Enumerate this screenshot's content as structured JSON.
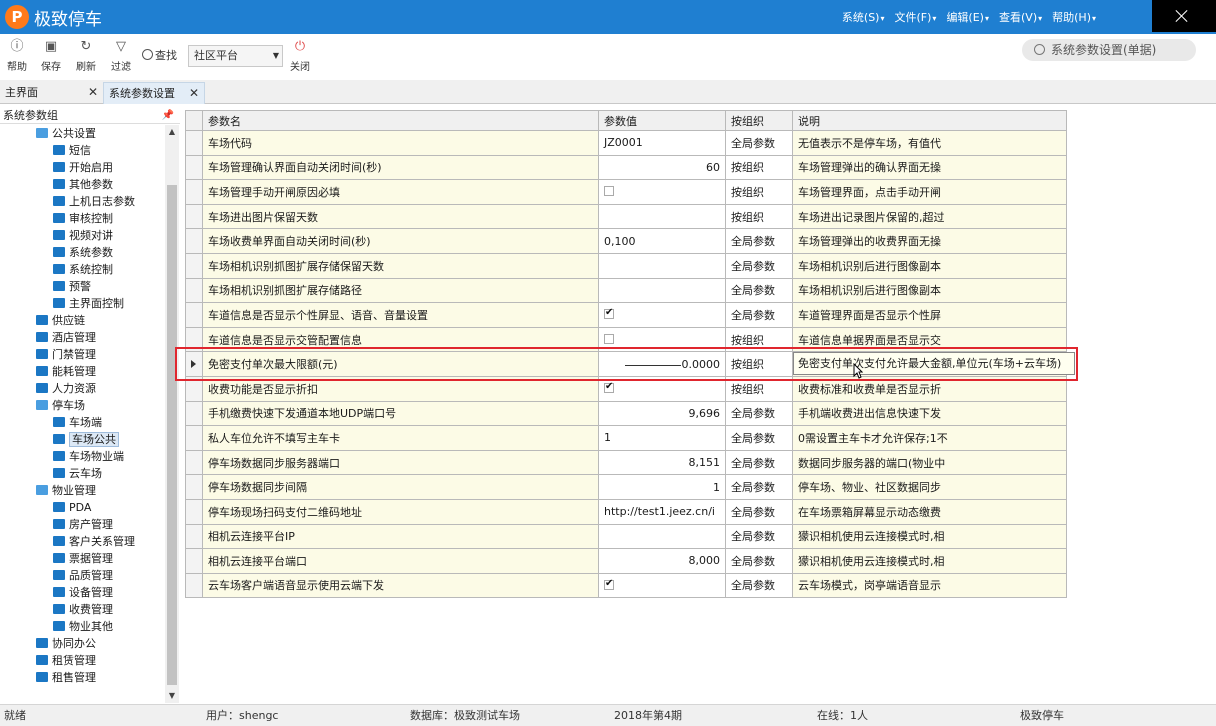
{
  "app": {
    "title": "极致停车",
    "logo_letter": "P"
  },
  "menubar": [
    "系统(S)",
    "文件(F)",
    "编辑(E)",
    "查看(V)",
    "帮助(H)"
  ],
  "toolbar": {
    "help": "帮助",
    "save": "保存",
    "refresh": "刷新",
    "filter": "过滤",
    "search": "查找",
    "scope_value": "社区平台",
    "close": "关闭"
  },
  "page_search_text": "系统参数设置(单据)",
  "tabs": [
    {
      "label": "主界面"
    },
    {
      "label": "系统参数设置"
    }
  ],
  "left_panel": {
    "title": "系统参数组",
    "tree": [
      {
        "label": "公共设置",
        "level": 1,
        "open": true
      },
      {
        "label": "短信",
        "level": 2
      },
      {
        "label": "开始启用",
        "level": 2
      },
      {
        "label": "其他参数",
        "level": 2
      },
      {
        "label": "上机日志参数",
        "level": 2
      },
      {
        "label": "审核控制",
        "level": 2
      },
      {
        "label": "视频对讲",
        "level": 2
      },
      {
        "label": "系统参数",
        "level": 2
      },
      {
        "label": "系统控制",
        "level": 2
      },
      {
        "label": "预警",
        "level": 2
      },
      {
        "label": "主界面控制",
        "level": 2
      },
      {
        "label": "供应链",
        "level": 1
      },
      {
        "label": "酒店管理",
        "level": 1
      },
      {
        "label": "门禁管理",
        "level": 1
      },
      {
        "label": "能耗管理",
        "level": 1
      },
      {
        "label": "人力资源",
        "level": 1
      },
      {
        "label": "停车场",
        "level": 1,
        "open": true
      },
      {
        "label": "车场端",
        "level": 2
      },
      {
        "label": "车场公共",
        "level": 2,
        "selected": true
      },
      {
        "label": "车场物业端",
        "level": 2
      },
      {
        "label": "云车场",
        "level": 2
      },
      {
        "label": "物业管理",
        "level": 1,
        "open": true
      },
      {
        "label": "PDA",
        "level": 2
      },
      {
        "label": "房产管理",
        "level": 2
      },
      {
        "label": "客户关系管理",
        "level": 2
      },
      {
        "label": "票据管理",
        "level": 2
      },
      {
        "label": "品质管理",
        "level": 2
      },
      {
        "label": "设备管理",
        "level": 2
      },
      {
        "label": "收费管理",
        "level": 2
      },
      {
        "label": "物业其他",
        "level": 2
      },
      {
        "label": "协同办公",
        "level": 1
      },
      {
        "label": "租赁管理",
        "level": 1
      },
      {
        "label": "租售管理",
        "level": 1
      }
    ]
  },
  "grid": {
    "columns": [
      "参数名",
      "参数值",
      "按组织",
      "说明"
    ],
    "rows": [
      {
        "name": "车场代码",
        "value": "JZ0001",
        "align": "left",
        "org": "全局参数",
        "desc": "无值表示不是停车场，有值代"
      },
      {
        "name": "车场管理确认界面自动关闭时间(秒)",
        "value": "60",
        "align": "right",
        "org": "按组织",
        "desc": "车场管理弹出的确认界面无操"
      },
      {
        "name": "车场管理手动开闸原因必填",
        "checkbox": true,
        "checked": false,
        "org": "按组织",
        "desc": "车场管理界面，点击手动开闸"
      },
      {
        "name": "车场进出图片保留天数",
        "value": "",
        "align": "left",
        "org": "按组织",
        "desc": "车场进出记录图片保留的,超过"
      },
      {
        "name": "车场收费单界面自动关闭时间(秒)",
        "value": "0,100",
        "align": "left",
        "org": "全局参数",
        "desc": "车场管理弹出的收费界面无操"
      },
      {
        "name": "车场相机识别抓图扩展存储保留天数",
        "value": "",
        "align": "left",
        "org": "全局参数",
        "desc": "车场相机识别后进行图像副本"
      },
      {
        "name": "车场相机识别抓图扩展存储路径",
        "value": "",
        "align": "left",
        "org": "全局参数",
        "desc": "车场相机识别后进行图像副本"
      },
      {
        "name": "车道信息是否显示个性屏显、语音、音量设置",
        "checkbox": true,
        "checked": true,
        "org": "全局参数",
        "desc": "车道管理界面是否显示个性屏"
      },
      {
        "name": "车道信息是否显示交管配置信息",
        "checkbox": true,
        "checked": false,
        "org": "按组织",
        "desc": "车道信息单据界面是否显示交"
      },
      {
        "name": "免密支付单次最大限额(元)",
        "value": "0.0000",
        "align": "right",
        "blank": true,
        "org": "按组织",
        "desc": "免密支付单次支付允许最大金额,单位元(车场+云车场)",
        "current": true
      },
      {
        "name": "收费功能是否显示折扣",
        "checkbox": true,
        "checked": true,
        "org": "按组织",
        "desc": "收费标准和收费单是否显示折"
      },
      {
        "name": "手机缴费快速下发通道本地UDP端口号",
        "value": "9,696",
        "align": "right",
        "org": "全局参数",
        "desc": "手机端收费进出信息快速下发"
      },
      {
        "name": "私人车位允许不填写主车卡",
        "value": "1",
        "align": "left",
        "org": "全局参数",
        "desc": "0需设置主车卡才允许保存;1不"
      },
      {
        "name": "停车场数据同步服务器端口",
        "value": "8,151",
        "align": "right",
        "org": "全局参数",
        "desc": "数据同步服务器的端口(物业中"
      },
      {
        "name": "停车场数据同步间隔",
        "value": "1",
        "align": "right",
        "org": "全局参数",
        "desc": "停车场、物业、社区数据同步"
      },
      {
        "name": "停车场现场扫码支付二维码地址",
        "value": "http://test1.jeez.cn/i",
        "align": "left",
        "org": "全局参数",
        "desc": "在车场票箱屏幕显示动态缴费"
      },
      {
        "name": "相机云连接平台IP",
        "value": "",
        "align": "left",
        "org": "全局参数",
        "desc": "獴识相机使用云连接模式时,相"
      },
      {
        "name": "相机云连接平台端口",
        "value": "8,000",
        "align": "right",
        "org": "全局参数",
        "desc": "獴识相机使用云连接模式时,相"
      },
      {
        "name": "云车场客户端语音显示使用云端下发",
        "checkbox": true,
        "checked": true,
        "org": "全局参数",
        "desc": "云车场模式，岗亭端语音显示"
      }
    ]
  },
  "tooltip": "免密支付单次支付允许最大金额,单位元(车场+云车场)",
  "status": {
    "state": "就绪",
    "user": "用户：shengc",
    "db": "数据库：极致测试车场",
    "period": "2018年第4期",
    "online": "在线：1人",
    "brand": "极致停车"
  },
  "colors": {
    "titlebar": "#1f7fd1",
    "logo": "#ff7a1a",
    "highlight": "#e0262e",
    "name_cell": "#fcfbe6"
  }
}
